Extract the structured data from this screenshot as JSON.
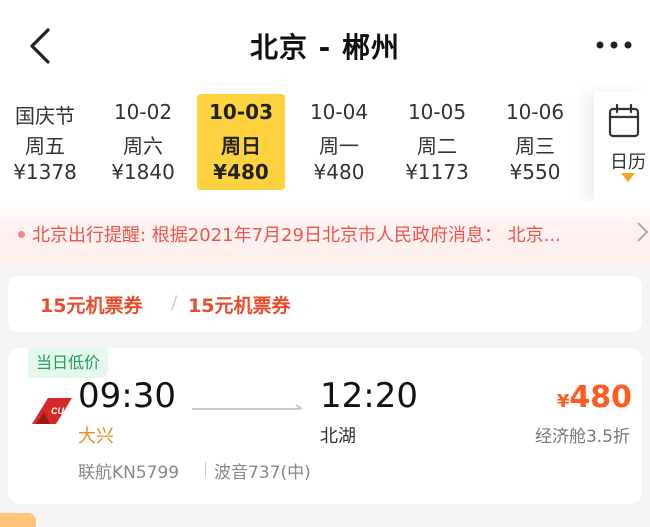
{
  "header": {
    "title": "北京 - 郴州"
  },
  "dates": [
    {
      "date": "国庆节",
      "weekday": "周五",
      "price": "¥1378"
    },
    {
      "date": "10-02",
      "weekday": "周六",
      "price": "¥1840"
    },
    {
      "date": "10-03",
      "weekday": "周日",
      "price": "¥480",
      "selected": true
    },
    {
      "date": "10-04",
      "weekday": "周一",
      "price": "¥480"
    },
    {
      "date": "10-05",
      "weekday": "周二",
      "price": "¥1173"
    },
    {
      "date": "10-06",
      "weekday": "周三",
      "price": "¥550"
    }
  ],
  "calendar": {
    "label": "日历"
  },
  "notice": {
    "text": "北京出行提醒: 根据2021年7月29日北京市人民政府消息： 北京..."
  },
  "coupons": {
    "first": "15元机票券",
    "separator": "/",
    "second": "15元机票券"
  },
  "flight": {
    "badge": "当日低价",
    "airline_logo": "CUA",
    "dep_time": "09:30",
    "dep_airport": "大兴",
    "arr_time": "12:20",
    "arr_airport": "北湖",
    "currency": "¥",
    "price": "480",
    "cabin": "经济舱3.5折",
    "flight_no": "联航KN5799",
    "aircraft": "波音737(中)"
  },
  "colors": {
    "accent": "#ffd23f",
    "price": "#ff5a1f",
    "notice": "#e8574d",
    "coupon": "#e84c2b",
    "badge": "#1aa05c"
  }
}
